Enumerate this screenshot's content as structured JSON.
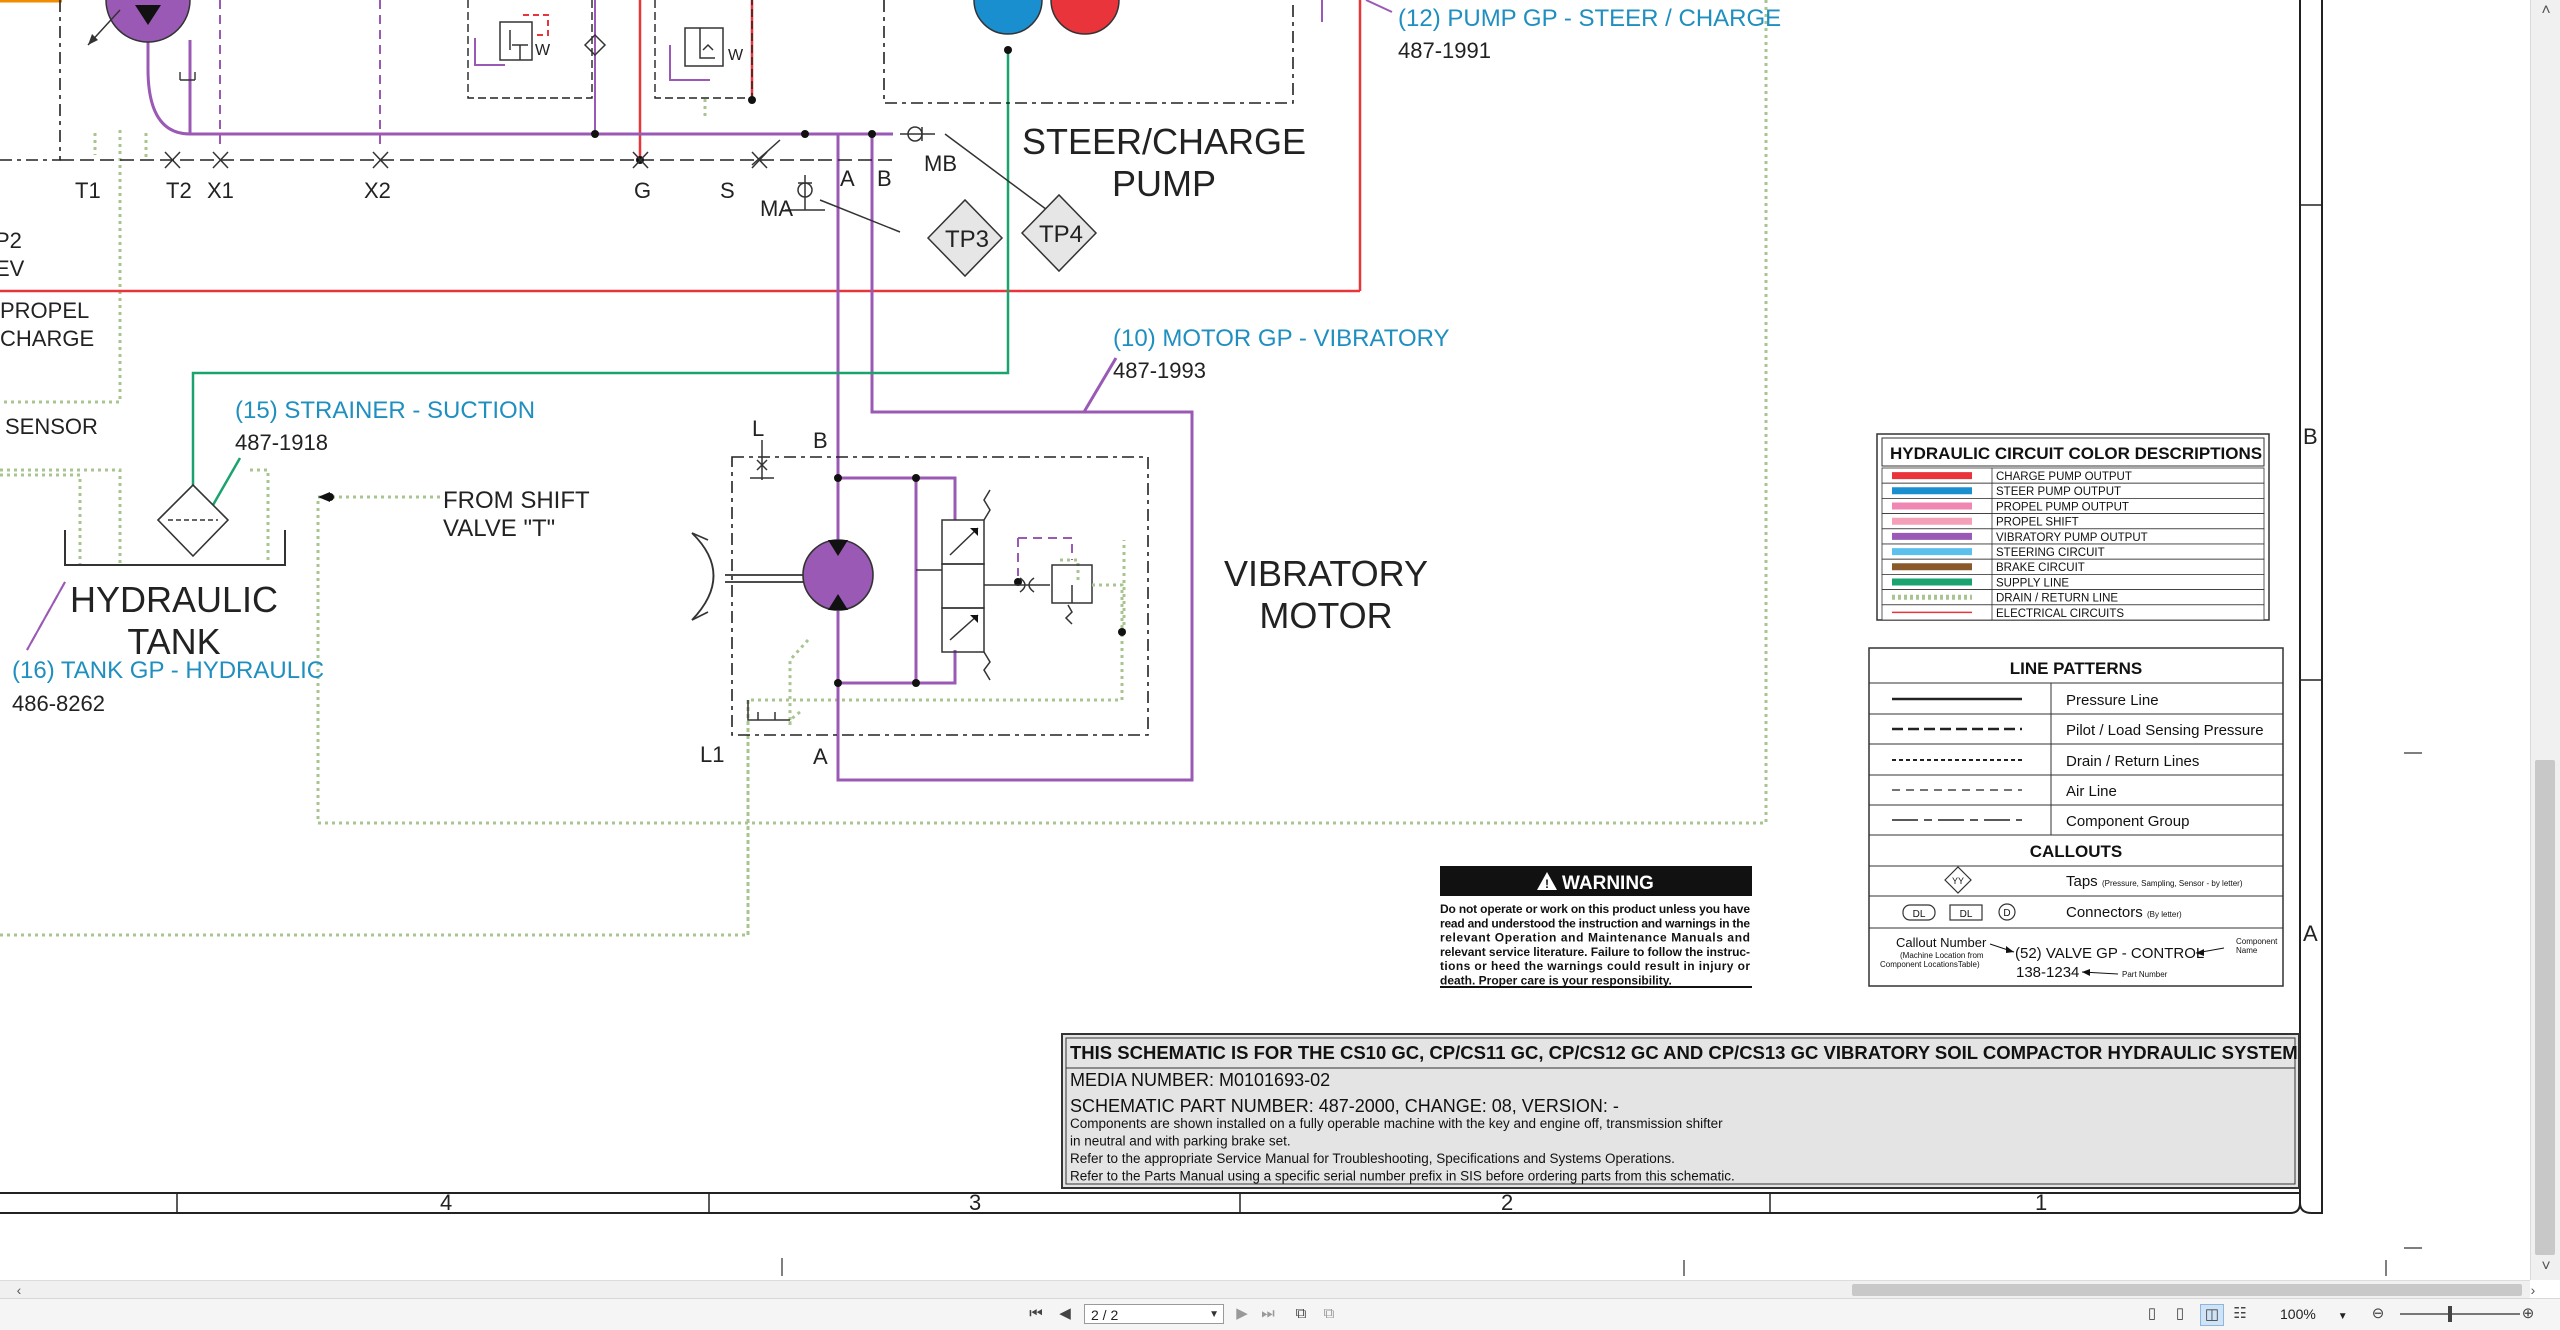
{
  "colors": {
    "charge_pump": "#e8343a",
    "steer_pump": "#1a8fd0",
    "propel_pump": "#ef87b2",
    "propel_shift": "#f4a0b8",
    "vibratory": "#9b59b6",
    "steering": "#5bc0eb",
    "brake": "#8b5a2b",
    "supply": "#1aa36f",
    "drain": "#a8c490",
    "callout": "#1f8fc0"
  },
  "labels": {
    "t1": "T1",
    "t2": "T2",
    "x1": "X1",
    "x2": "X2",
    "g": "G",
    "s": "S",
    "ma": "MA",
    "a": "A",
    "b": "B",
    "mb": "MB",
    "tp3": "TP3",
    "tp4": "TP4",
    "p2": "P2",
    "ev": "EV",
    "propel": "PROPEL",
    "charge": "CHARGE",
    "sensor": "SENSOR",
    "steer_charge_1": "STEER/CHARGE",
    "steer_charge_2": "PUMP",
    "vib_motor_1": "VIBRATORY",
    "vib_motor_2": "MOTOR",
    "hyd_tank_1": "HYDRAULIC",
    "hyd_tank_2": "TANK",
    "from_shift_1": "FROM SHIFT",
    "from_shift_2": "VALVE \"T\"",
    "l": "L",
    "b2": "B",
    "l1": "L1",
    "a2": "A",
    "w1": "W",
    "w2": "W"
  },
  "callouts": {
    "pump_gp": "(12) PUMP GP -  STEER / CHARGE",
    "pump_gp_pn": "487-1991",
    "motor_gp": "(10) MOTOR GP -  VIBRATORY",
    "motor_gp_pn": "487-1993",
    "strainer": "(15) STRAINER -  SUCTION",
    "strainer_pn": "487-1918",
    "tank_gp": "(16) TANK GP -  HYDRAULIC",
    "tank_gp_pn": "486-8262"
  },
  "color_legend": {
    "title": "HYDRAULIC CIRCUIT COLOR DESCRIPTIONS",
    "items": [
      {
        "label": "CHARGE PUMP OUTPUT",
        "color": "#e8343a",
        "style": "solid"
      },
      {
        "label": "STEER PUMP OUTPUT",
        "color": "#1a8fd0",
        "style": "solid"
      },
      {
        "label": "PROPEL PUMP OUTPUT",
        "color": "#ef87b2",
        "style": "solid"
      },
      {
        "label": "PROPEL SHIFT",
        "color": "#f4a0b8",
        "style": "solid"
      },
      {
        "label": "VIBRATORY PUMP OUTPUT",
        "color": "#9b59b6",
        "style": "solid"
      },
      {
        "label": "STEERING CIRCUIT",
        "color": "#5bc0eb",
        "style": "solid"
      },
      {
        "label": "BRAKE CIRCUIT",
        "color": "#8b5a2b",
        "style": "solid"
      },
      {
        "label": "SUPPLY LINE",
        "color": "#1aa36f",
        "style": "solid"
      },
      {
        "label": "DRAIN / RETURN LINE",
        "color": "#a8c490",
        "style": "dotted"
      },
      {
        "label": "ELECTRICAL CIRCUITS",
        "color": "#e8343a",
        "style": "thin"
      }
    ]
  },
  "line_patterns": {
    "title": "LINE PATTERNS",
    "items": [
      "Pressure Line",
      "Pilot / Load Sensing Pressure",
      "Drain / Return Lines",
      "Air Line",
      "Component Group"
    ],
    "callouts_title": "CALLOUTS",
    "taps_label": "Taps",
    "taps_note": "(Pressure, Sampling, Sensor - by letter)",
    "taps_symbol": "YY",
    "connectors_label": "Connectors",
    "connectors_note": "(By letter)",
    "dl": "DL",
    "d": "D",
    "callout_number": "Callout Number",
    "callout_number_note1": "(Machine Location from",
    "callout_number_note2": "Component LocationsTable)",
    "example_name": "(52) VALVE GP - CONTROL",
    "example_pn": "138-1234",
    "component_name_1": "Component",
    "component_name_2": "Name",
    "part_number": "Part Number"
  },
  "warning": {
    "title": "WARNING",
    "lines": [
      "Do not operate or work on this product unless you have",
      "read and understood the instruction and warnings in the",
      "relevant Operation and Maintenance Manuals and",
      "relevant service literature. Failure to follow the instruc-",
      "tions or heed the warnings could result in injury or",
      "death. Proper care is your responsibility."
    ]
  },
  "title_block": {
    "heading": "THIS SCHEMATIC IS FOR THE CS10 GC, CP/CS11 GC, CP/CS12 GC AND CP/CS13 GC VIBRATORY SOIL COMPACTOR HYDRAULIC SYSTEM",
    "media": "MEDIA NUMBER: M0101693-02",
    "part": "SCHEMATIC PART NUMBER: 487-2000, CHANGE: 08, VERSION: -",
    "notes": [
      "Components are shown installed on a fully operable machine with the key and engine off, transmission shifter",
      "in neutral and with parking brake set.",
      "Refer to the appropriate Service Manual for Troubleshooting, Specifications and Systems Operations.",
      "Refer to the Parts Manual using a specific serial number prefix in SIS before ordering parts from this schematic."
    ]
  },
  "border": {
    "columns": [
      "4",
      "3",
      "2",
      "1"
    ],
    "rows": [
      "B",
      "A"
    ]
  },
  "viewer": {
    "page_value": "2 / 2",
    "zoom": "100%",
    "icons": [
      "first-page-icon",
      "prev-page-icon",
      "next-page-icon",
      "last-page-icon",
      "fit-icon",
      "rotate-icon",
      "single-page-icon",
      "continuous-icon",
      "two-page-icon",
      "spread-icon",
      "zoom-out-icon",
      "zoom-in-icon"
    ]
  }
}
